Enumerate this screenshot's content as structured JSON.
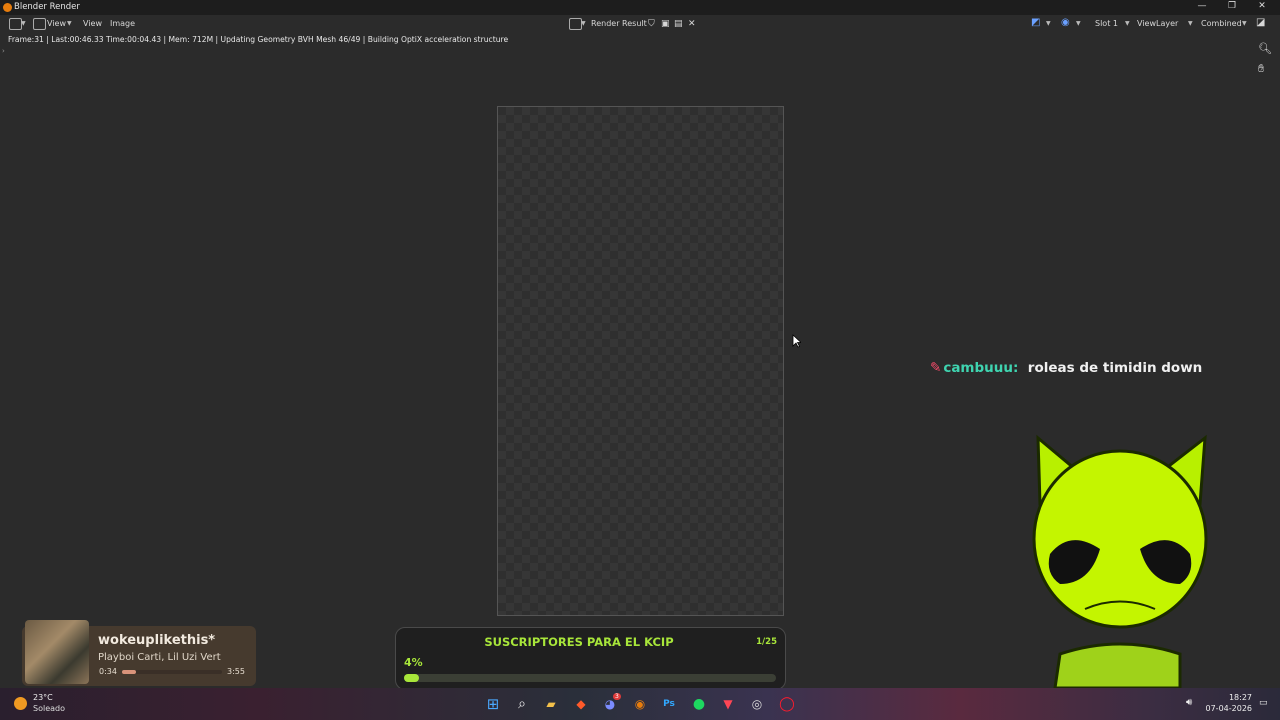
{
  "window": {
    "title": "Blender Render",
    "controls": [
      "—",
      "❐",
      "✕"
    ]
  },
  "menubar": {
    "items": [
      "View",
      "View",
      "Image"
    ],
    "image_name": "Render Result",
    "slot": "Slot 1",
    "view_layer": "ViewLayer",
    "pass": "Combined"
  },
  "status": {
    "text": "Frame:31 | Last:00:46.33 Time:00:04.43 | Mem: 712M | Updating Geometry BVH Mesh 46/49 | Building OptiX acceleration structure"
  },
  "chat": {
    "user": "cambuuu:",
    "message": "roleas de timidin down"
  },
  "music": {
    "song": "wokeuplikethis*",
    "artist": "Playboi Carti, Lil Uzi Vert",
    "elapsed": "0:34",
    "duration": "3:55",
    "progress_fraction": 0.14
  },
  "subscribers": {
    "title": "SUSCRIPTORES PARA EL KCIP",
    "count": "1/25",
    "percent_label": "4%",
    "progress_fraction": 0.04
  },
  "taskbar": {
    "temperature": "23°C",
    "condition": "Soleado",
    "time": "18:27",
    "date": "07-04-2026",
    "apps": [
      "windows-start-icon",
      "search-icon",
      "file-explorer-icon",
      "brave-browser-icon",
      "discord-icon",
      "blender-icon",
      "photoshop-icon",
      "spotify-icon",
      "valorant-icon",
      "app-icon",
      "opera-gx-icon"
    ],
    "discord_badge": "3"
  },
  "colors": {
    "accent_green": "#a8e63a",
    "blender_orange": "#e87d0d",
    "chat_user": "#3fd4b0"
  }
}
